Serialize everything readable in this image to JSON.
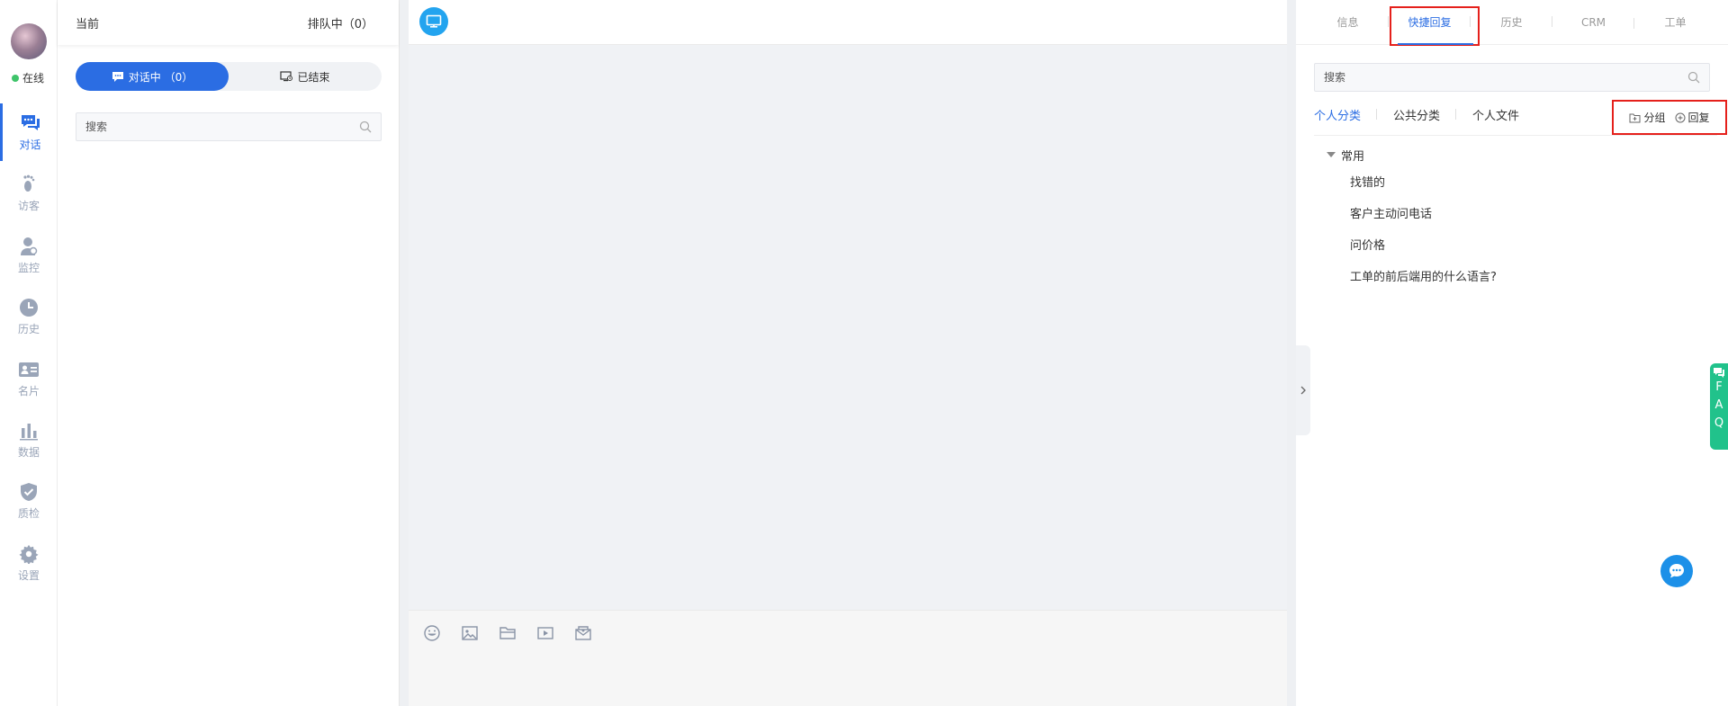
{
  "rail": {
    "status": "在线",
    "items": [
      {
        "label": "对话",
        "icon": "chat-icon",
        "active": true
      },
      {
        "label": "访客",
        "icon": "footprint-icon"
      },
      {
        "label": "监控",
        "icon": "monitor-user-icon"
      },
      {
        "label": "历史",
        "icon": "clock-icon"
      },
      {
        "label": "名片",
        "icon": "id-card-icon"
      },
      {
        "label": "数据",
        "icon": "bar-chart-icon"
      },
      {
        "label": "质检",
        "icon": "shield-check-icon"
      },
      {
        "label": "设置",
        "icon": "gear-icon"
      }
    ]
  },
  "list": {
    "current_label": "当前",
    "queue_label": "排队中（0）",
    "seg_active": "对话中 （0）",
    "seg_ended": "已结束",
    "search_placeholder": "搜索"
  },
  "right": {
    "tabs": [
      "信息",
      "快捷回复",
      "历史",
      "CRM",
      "工单"
    ],
    "active_tab": "快捷回复",
    "search_placeholder": "搜索",
    "subtabs": [
      "个人分类",
      "公共分类",
      "个人文件"
    ],
    "group_btn": "分组",
    "reply_btn": "回复",
    "folder": "常用",
    "replies": [
      "找错的",
      "客户主动问电话",
      "问价格",
      "工单的前后端用的什么语言?"
    ]
  },
  "faq": [
    "F",
    "A",
    "Q"
  ],
  "colors": {
    "accent": "#2b6de3",
    "highlight": "#e5201b",
    "faq": "#21c28b"
  }
}
